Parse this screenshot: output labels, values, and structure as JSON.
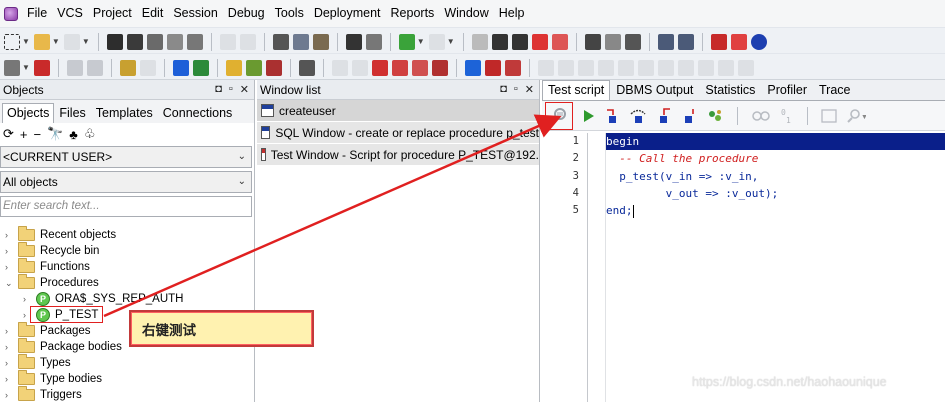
{
  "menubar": {
    "items": [
      "File",
      "VCS",
      "Project",
      "Edit",
      "Session",
      "Debug",
      "Tools",
      "Deployment",
      "Reports",
      "Window",
      "Help"
    ]
  },
  "objects_panel": {
    "title": "Objects",
    "tabs": [
      "Objects",
      "Files",
      "Templates",
      "Connections"
    ],
    "user_select": "<CURRENT USER>",
    "filter_select": "All objects",
    "search_placeholder": "Enter search text...",
    "tree": [
      {
        "label": "Recent objects",
        "type": "folder",
        "expanded": false
      },
      {
        "label": "Recycle bin",
        "type": "folder",
        "expanded": false
      },
      {
        "label": "Functions",
        "type": "folder",
        "expanded": false
      },
      {
        "label": "Procedures",
        "type": "folder",
        "expanded": true
      },
      {
        "label": "ORA$_SYS_REP_AUTH",
        "type": "procedure",
        "expanded": false
      },
      {
        "label": "P_TEST",
        "type": "procedure",
        "expanded": false
      },
      {
        "label": "Packages",
        "type": "folder",
        "expanded": false
      },
      {
        "label": "Package bodies",
        "type": "folder",
        "expanded": false
      },
      {
        "label": "Types",
        "type": "folder",
        "expanded": false
      },
      {
        "label": "Type bodies",
        "type": "folder",
        "expanded": false
      },
      {
        "label": "Triggers",
        "type": "folder",
        "expanded": false
      }
    ]
  },
  "window_list": {
    "title": "Window list",
    "items": [
      {
        "label": "createuser",
        "kind": "sql"
      },
      {
        "label": "SQL Window - create or replace procedure p_test",
        "kind": "sql"
      },
      {
        "label": "Test Window - Script for procedure P_TEST@192.",
        "kind": "test"
      }
    ]
  },
  "test_window": {
    "tabs": [
      "Test script",
      "DBMS Output",
      "Statistics",
      "Profiler",
      "Trace"
    ],
    "line_numbers": [
      "1",
      "2",
      "3",
      "4",
      "5"
    ],
    "code_lines": [
      "begin",
      "  -- Call the procedure",
      "  p_test(v_in => :v_in,",
      "         v_out => :v_out);",
      "end;"
    ]
  },
  "callout": {
    "text": "右键测试"
  },
  "watermark": {
    "text": "https://blog.csdn.net/haohaounique"
  },
  "colors": {
    "annotation_red": "#e02020",
    "callout_fill": "#fff2b0",
    "editor_selection": "#0a1f8a",
    "comment_red": "#d02020"
  }
}
